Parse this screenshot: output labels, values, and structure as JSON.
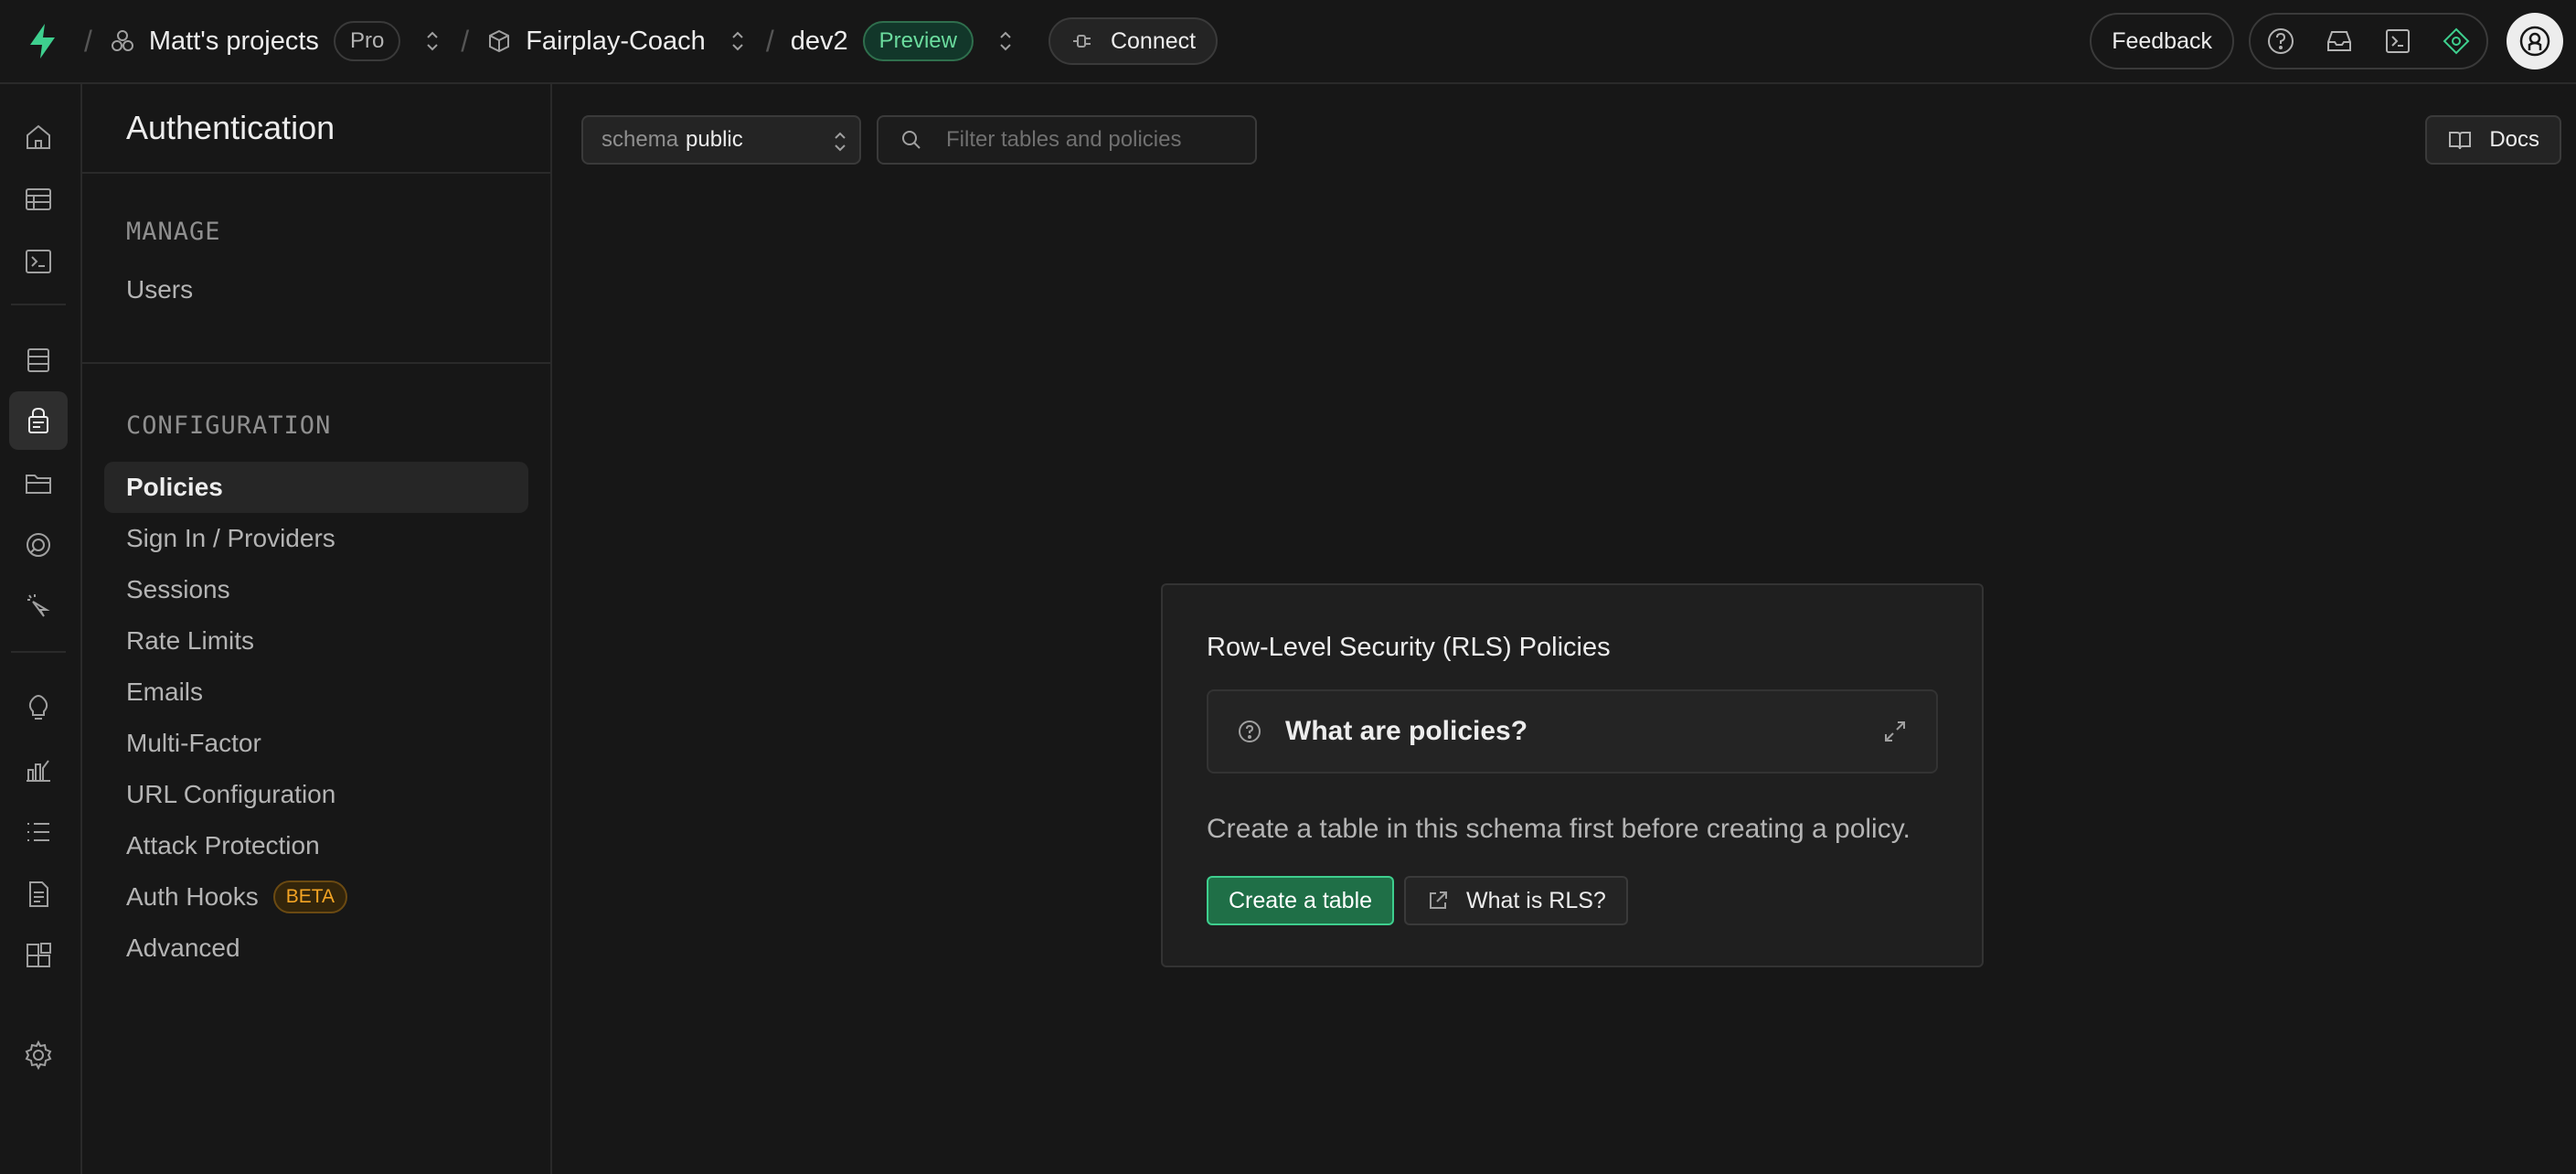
{
  "colors": {
    "accent": "#3ecf8e",
    "background": "#171717",
    "beta": "#f5a524"
  },
  "header": {
    "org_name": "Matt's projects",
    "plan_badge": "Pro",
    "project_name": "Fairplay-Coach",
    "branch_name": "dev2",
    "branch_badge": "Preview",
    "connect_label": "Connect",
    "feedback_label": "Feedback",
    "icons": [
      "help-icon",
      "inbox-icon",
      "terminal-icon",
      "advisor-icon",
      "user-avatar-icon"
    ]
  },
  "rail": {
    "items": [
      "home-icon",
      "table-editor-icon",
      "sql-editor-icon",
      "database-icon",
      "authentication-icon",
      "storage-icon",
      "realtime-icon",
      "edge-functions-icon",
      "advisors-icon",
      "reports-icon",
      "logs-icon",
      "api-docs-icon",
      "integrations-icon",
      "settings-icon"
    ],
    "active": "authentication-icon"
  },
  "sidebar": {
    "title": "Authentication",
    "sections": [
      {
        "label": "MANAGE",
        "items": [
          {
            "label": "Users"
          }
        ]
      },
      {
        "label": "CONFIGURATION",
        "items": [
          {
            "label": "Policies",
            "active": true
          },
          {
            "label": "Sign In / Providers"
          },
          {
            "label": "Sessions"
          },
          {
            "label": "Rate Limits"
          },
          {
            "label": "Emails"
          },
          {
            "label": "Multi-Factor"
          },
          {
            "label": "URL Configuration"
          },
          {
            "label": "Attack Protection"
          },
          {
            "label": "Auth Hooks",
            "badge": "BETA"
          },
          {
            "label": "Advanced"
          }
        ]
      }
    ]
  },
  "toolbar": {
    "schema_label": "schema",
    "schema_value": "public",
    "filter_placeholder": "Filter tables and policies",
    "filter_value": "",
    "docs_label": "Docs"
  },
  "card": {
    "title": "Row-Level Security (RLS) Policies",
    "accordion_label": "What are policies?",
    "body": "Create a table in this schema first before creating a policy.",
    "primary_button": "Create a table",
    "secondary_button": "What is RLS?"
  }
}
